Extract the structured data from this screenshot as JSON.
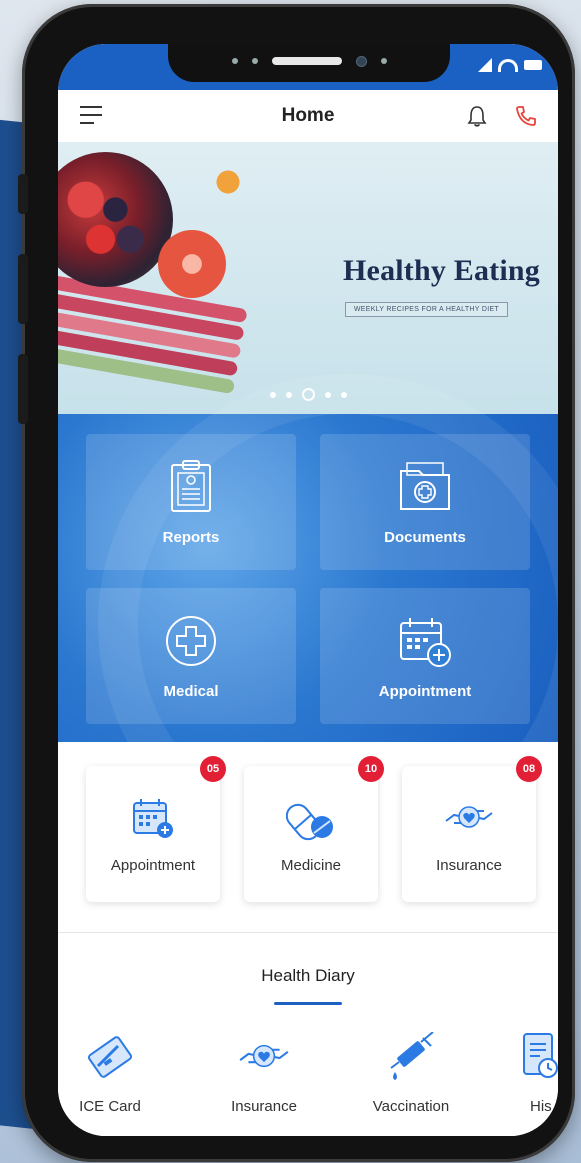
{
  "header": {
    "title": "Home"
  },
  "banner": {
    "title": "Healthy Eating",
    "subtitle": "WEEKLY RECIPES FOR A HEALTHY DIET",
    "dots": 5,
    "active_dot": 3
  },
  "tiles": [
    {
      "label": "Reports",
      "icon": "clipboard-report-icon"
    },
    {
      "label": "Documents",
      "icon": "folder-medical-icon"
    },
    {
      "label": "Medical",
      "icon": "medical-cross-icon"
    },
    {
      "label": "Appointment",
      "icon": "calendar-plus-icon"
    }
  ],
  "quick": [
    {
      "label": "Appointment",
      "badge": "05",
      "icon": "calendar-icon"
    },
    {
      "label": "Medicine",
      "badge": "10",
      "icon": "pill-icon"
    },
    {
      "label": "Insurance",
      "badge": "08",
      "icon": "hands-heart-icon"
    }
  ],
  "diary": {
    "title": "Health Diary",
    "items": [
      {
        "label": "ICE Card",
        "icon": "card-icon"
      },
      {
        "label": "Insurance",
        "icon": "hands-heart-icon"
      },
      {
        "label": "Vaccination",
        "icon": "syringe-icon"
      },
      {
        "label": "His",
        "icon": "history-document-icon"
      }
    ]
  },
  "colors": {
    "primary": "#1b61c4",
    "badge": "#e21f35",
    "call": "#e8433a",
    "icon_blue": "#2c7be5"
  }
}
